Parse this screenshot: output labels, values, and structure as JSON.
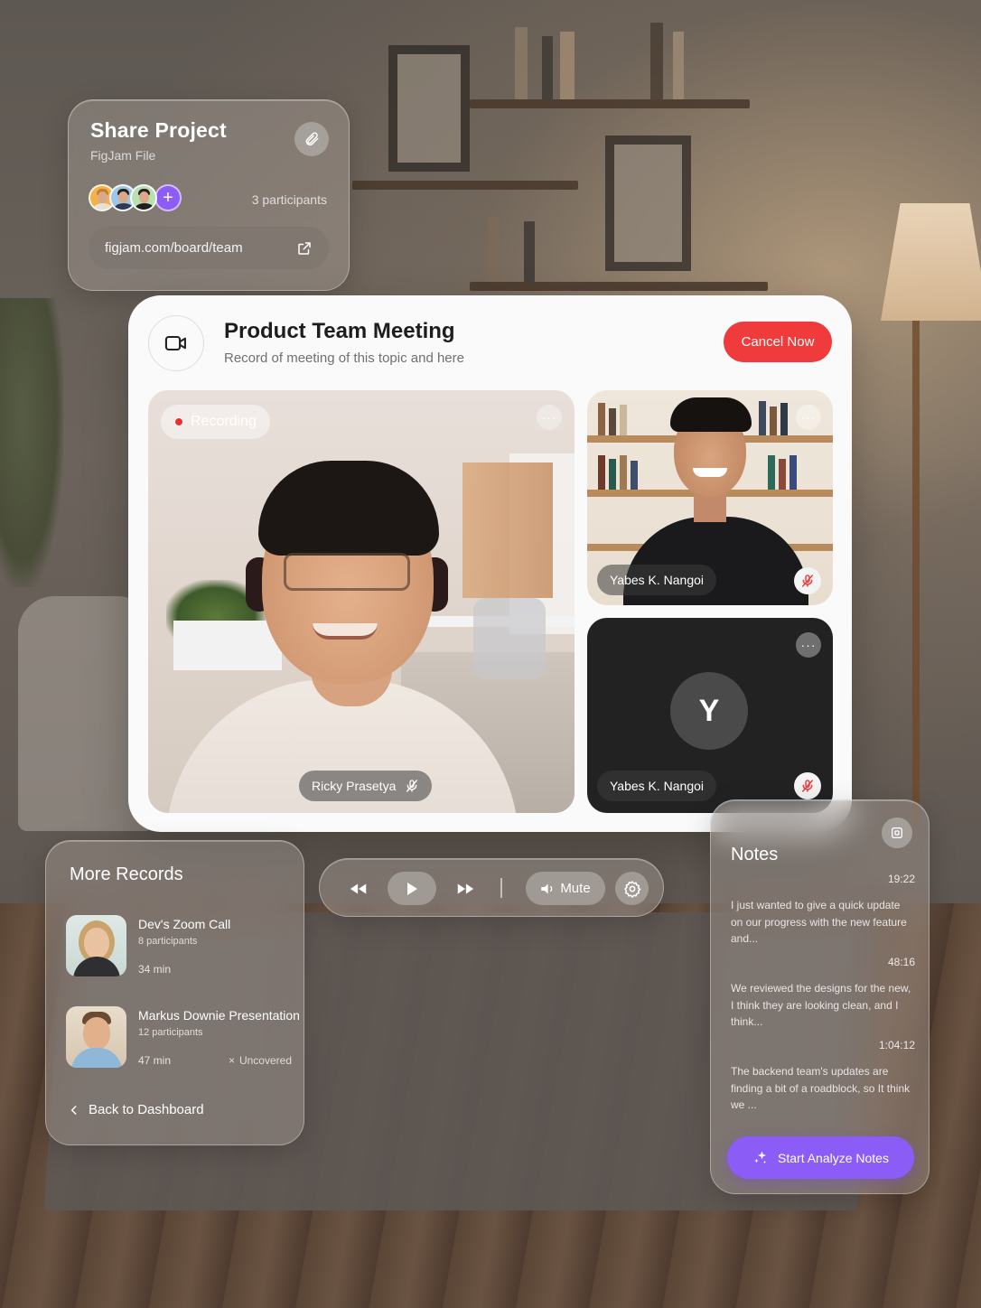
{
  "share": {
    "title": "Share Project",
    "subtitle": "FigJam File",
    "participants": "3 participants",
    "link": "figjam.com/board/team",
    "add_label": "+"
  },
  "meeting": {
    "title": "Product Team Meeting",
    "subtitle": "Record of meeting of this topic and here",
    "cancel_label": "Cancel Now",
    "recording_label": "Recording",
    "main_speaker": "Ricky Prasetya",
    "tiles": [
      {
        "name": "Yabes K. Nangoi",
        "muted": true,
        "video": true
      },
      {
        "name": "Yabes K. Nangoi",
        "muted": true,
        "video": false,
        "initial": "Y"
      }
    ],
    "more_label": "···"
  },
  "records": {
    "title": "More Records",
    "items": [
      {
        "name": "Dev's Zoom Call",
        "participants": "8 participants",
        "duration": "34 min",
        "status": ""
      },
      {
        "name": "Markus Downie Presentation",
        "participants": "12 participants",
        "duration": "47 min",
        "status": "Uncovered"
      }
    ],
    "back_label": "Back to Dashboard"
  },
  "controls": {
    "mute_label": "Mute"
  },
  "notes": {
    "title": "Notes",
    "entries": [
      {
        "time": "19:22",
        "text": "I just wanted to give a quick update on our progress with the new feature and..."
      },
      {
        "time": "48:16",
        "text": "We reviewed the designs for the new, I think they are looking clean, and I think..."
      },
      {
        "time": "1:04:12",
        "text": "The backend team's updates are finding a bit of a roadblock, so It think we ..."
      }
    ],
    "analyze_label": "Start Analyze Notes"
  },
  "colors": {
    "accent_red": "#ef3b3b",
    "accent_purple": "#8b5cf6"
  }
}
